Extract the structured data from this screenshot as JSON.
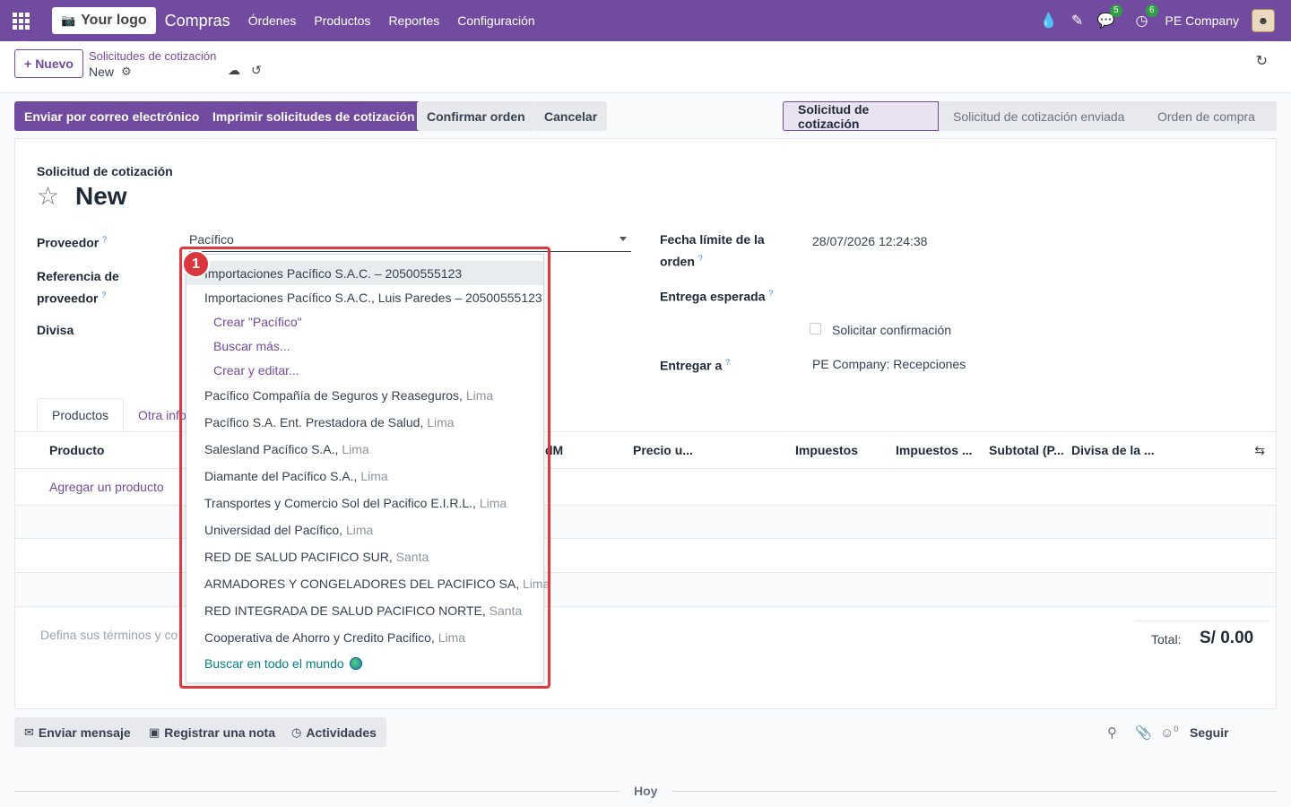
{
  "navbar": {
    "logo_text": "Your logo",
    "app_name": "Compras",
    "menu": [
      "Órdenes",
      "Productos",
      "Reportes",
      "Configuración"
    ],
    "messages_count": "5",
    "activities_count": "6",
    "company": "PE Company"
  },
  "control": {
    "new_label": "Nuevo",
    "breadcrumb": "Solicitudes de cotización",
    "record_name": "New"
  },
  "actions": {
    "send_email": "Enviar por correo electrónico",
    "print_rfq": "Imprimir solicitudes de cotización",
    "confirm": "Confirmar orden",
    "cancel": "Cancelar"
  },
  "statusbar": [
    "Solicitud de cotización",
    "Solicitud de cotización enviada",
    "Orden de compra"
  ],
  "form": {
    "doc_label": "Solicitud de cotización",
    "title": "New",
    "vendor_label": "Proveedor",
    "vendor_value": "Pacífico",
    "vendor_ref_label_1": "Referencia de",
    "vendor_ref_label_2": "proveedor",
    "currency_label": "Divisa",
    "deadline_label_1": "Fecha límite de la",
    "deadline_label_2": "orden",
    "deadline_value": "28/07/2026 12:24:38",
    "expected_label": "Entrega esperada",
    "ask_confirm": "Solicitar confirmación",
    "deliver_to_label": "Entregar a",
    "deliver_to_value": "PE Company: Recepciones",
    "help_mark": "?"
  },
  "tabs": [
    "Productos",
    "Otra info"
  ],
  "table": {
    "columns": [
      "Producto",
      "dM",
      "Precio u...",
      "Impuestos",
      "Impuestos ...",
      "Subtotal (P...",
      "Divisa de la ..."
    ],
    "add_product": "Agregar un producto",
    "terms_placeholder": "Defina sus términos y co",
    "total_label": "Total:",
    "total_value": "S/ 0.00"
  },
  "dropdown": {
    "items": [
      {
        "name": "Importaciones Pacífico S.A.C. – 20500555123",
        "city": ""
      },
      {
        "name": "Importaciones Pacífico S.A.C., Luis Paredes – 20500555123",
        "city": ""
      }
    ],
    "create": "Crear \"Pacífico\"",
    "search_more": "Buscar más...",
    "create_edit": "Crear y editar...",
    "results": [
      {
        "name": "Pacífico Compañía de Seguros y Reaseguros,",
        "city": "Lima"
      },
      {
        "name": "Pacífico S.A. Ent. Prestadora de Salud,",
        "city": "Lima"
      },
      {
        "name": "Salesland Pacífico S.A.,",
        "city": "Lima"
      },
      {
        "name": "Diamante del Pacífico S.A.,",
        "city": "Lima"
      },
      {
        "name": "Transportes y Comercio Sol del Pacifico E.I.R.L.,",
        "city": "Lima"
      },
      {
        "name": "Universidad del Pacífico,",
        "city": "Lima"
      },
      {
        "name": "RED DE SALUD PACIFICO SUR,",
        "city": "Santa"
      },
      {
        "name": "ARMADORES Y CONGELADORES DEL PACIFICO SA,",
        "city": "Lima"
      },
      {
        "name": "RED INTEGRADA DE SALUD PACIFICO NORTE,",
        "city": "Santa"
      },
      {
        "name": "Cooperativa de Ahorro y Credito Pacifico,",
        "city": "Lima"
      }
    ],
    "search_world": "Buscar en todo el mundo",
    "step_number": "1"
  },
  "chatter": {
    "send_message": "Enviar mensaje",
    "log_note": "Registrar una nota",
    "activities": "Actividades",
    "followers_count": "0",
    "follow": "Seguir",
    "today": "Hoy"
  }
}
